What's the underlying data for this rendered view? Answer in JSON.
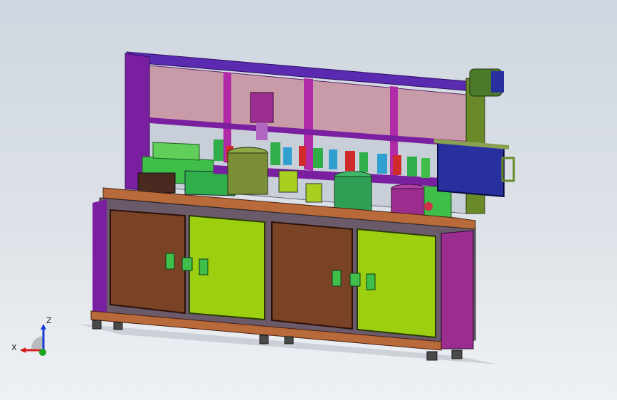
{
  "viewport": {
    "background_top": "#cfd6df",
    "background_bottom": "#eef1f4"
  },
  "model": {
    "colors": {
      "frame": "#7a1fa0",
      "frame_dark": "#4b1670",
      "frame_top": "#5a2ab0",
      "glass": "#c99aa8",
      "glass_lower": "#c9cfd8",
      "cabinet_brown": "#7a4326",
      "cabinet_lime": "#9ccf10",
      "cabinet_frame": "#6a6a6a",
      "table_top": "#b86a3a",
      "motor_magenta": "#9b2d8f",
      "motor_olive": "#7a8f35",
      "motor_green": "#2f9f55",
      "control_box": "#2830a0",
      "green_part": "#3fbf4a",
      "feet": "#4a4a4a"
    }
  },
  "triad": {
    "x_label": "X",
    "z_label": "Z",
    "x_color": "#d11d1d",
    "y_color": "#17a51c",
    "z_color": "#1a3ad6"
  }
}
